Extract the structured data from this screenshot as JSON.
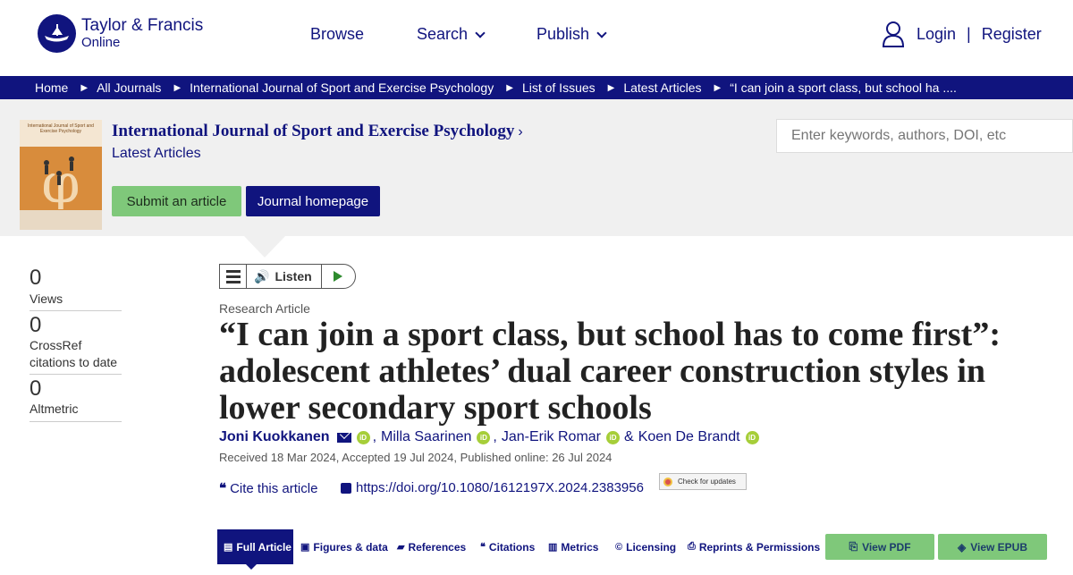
{
  "brand": {
    "line1": "Taylor & Francis",
    "line2": "Online",
    "color": "#10147e"
  },
  "nav": {
    "browse": "Browse",
    "search": "Search",
    "publish": "Publish"
  },
  "user": {
    "login": "Login",
    "sep": "|",
    "register": "Register"
  },
  "breadcrumb": [
    "Home",
    "All Journals",
    "International Journal of Sport and Exercise Psychology",
    "List of Issues",
    "Latest Articles",
    "“I can join a sport class, but school ha ...."
  ],
  "journal": {
    "title": "International Journal of Sport and Exercise Psychology",
    "chevron": "›",
    "subtitle": "Latest Articles",
    "submit_label": "Submit an article",
    "homepage_label": "Journal homepage",
    "cover_text": "International Journal of Sport and Exercise Psychology"
  },
  "search": {
    "placeholder": "Enter keywords, authors, DOI, etc"
  },
  "stats": [
    {
      "num": "0",
      "label": "Views"
    },
    {
      "num": "0",
      "label": "CrossRef citations to date"
    },
    {
      "num": "0",
      "label": "Altmetric"
    }
  ],
  "listen": {
    "label": "Listen"
  },
  "article": {
    "type": "Research Article",
    "title": "“I can join a sport class, but school has to come first”: adolescent athletes’ dual career construction styles in lower secondary sport schools",
    "authors": [
      "Joni Kuokkanen",
      "Milla Saarinen",
      "Jan-Erik Romar",
      "Koen De Brandt"
    ],
    "author_sep1": ",",
    "author_sep2": ",",
    "author_sep3": "&",
    "orcid_text": "iD",
    "dates": "Received 18 Mar 2024, Accepted 19 Jul 2024, Published online: 26 Jul 2024",
    "cite_label": "Cite this article",
    "doi": "https://doi.org/10.1080/1612197X.2024.2383956",
    "check_updates": "Check for updates"
  },
  "tabs": {
    "full": "Full Article",
    "figures": "Figures & data",
    "references": "References",
    "citations": "Citations",
    "metrics": "Metrics",
    "licensing": "Licensing",
    "reprints": "Reprints & Permissions",
    "pdf": "View PDF",
    "epub": "View EPUB"
  }
}
